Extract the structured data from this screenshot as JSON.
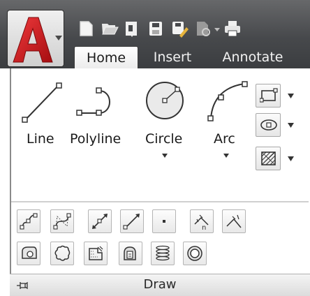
{
  "app": {
    "logo_letter": "A",
    "brand_color": "#d4161b"
  },
  "quick_access": {
    "icons": [
      "new-icon",
      "open-icon",
      "sheetset-icon",
      "save-icon",
      "save-as-icon",
      "plot-preview-icon",
      "print-icon"
    ]
  },
  "ribbon": {
    "tabs": [
      {
        "label": "Home",
        "active": true
      },
      {
        "label": "Insert",
        "active": false
      },
      {
        "label": "Annotate",
        "active": false
      }
    ]
  },
  "draw_panel": {
    "title": "Draw",
    "big_tools": [
      {
        "label": "Line",
        "has_dropdown": false
      },
      {
        "label": "Polyline",
        "has_dropdown": false
      },
      {
        "label": "Circle",
        "has_dropdown": true
      },
      {
        "label": "Arc",
        "has_dropdown": true
      }
    ],
    "side_tools": [
      "rectangle-icon",
      "ellipse-icon",
      "hatch-icon"
    ],
    "row1_tools": [
      "spline-fit-icon",
      "spline-cv-icon",
      "construction-line-icon",
      "ray-icon",
      "point-icon",
      "divide-icon",
      "measure-icon"
    ],
    "row2_tools": [
      "region-icon",
      "revision-cloud-icon",
      "wipeout-icon",
      "boundary-icon",
      "helix-icon",
      "donut-icon"
    ]
  }
}
